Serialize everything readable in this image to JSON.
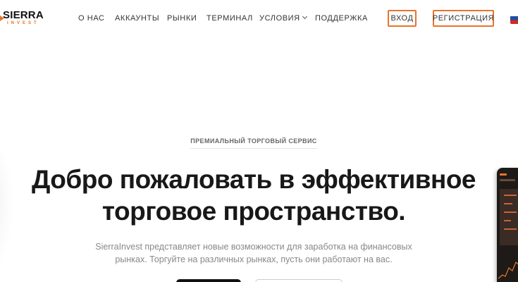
{
  "header": {
    "logo": {
      "top": "SIERRA",
      "bottom": "INVEST"
    },
    "nav": [
      {
        "label": "О НАС"
      },
      {
        "label": "АККАУНТЫ"
      },
      {
        "label": "РЫНКИ"
      },
      {
        "label": "ТЕРМИНАЛ"
      },
      {
        "label": "УСЛОВИЯ"
      },
      {
        "label": "ПОДДЕРЖКА"
      }
    ],
    "login_label": "ВХОД",
    "register_label": "РЕГИСТРАЦИЯ",
    "language_flag": "russian-flag",
    "accent_color": "#e8742a"
  },
  "hero": {
    "eyebrow": "ПРЕМИАЛЬНЫЙ ТОРГОВЫЙ СЕРВИС",
    "title_line1": "Добро пожаловать в эффективное",
    "title_line2": "торговое пространство.",
    "subtitle_line1": "SierraInvest представляет новые возможности для заработка на финансовых",
    "subtitle_line2": "рынках. Торгуйте на различных рынках, пусть они работают на вас."
  }
}
